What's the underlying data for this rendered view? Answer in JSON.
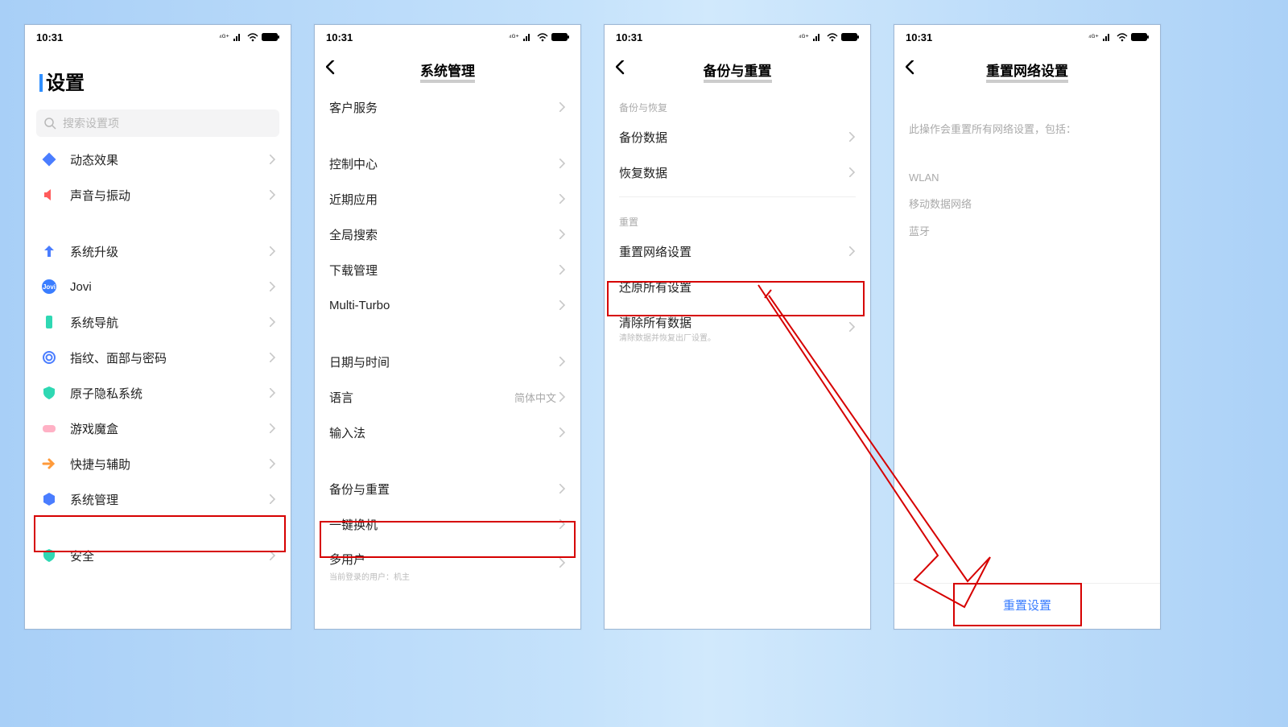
{
  "status": {
    "time": "10:31",
    "carrier_small": "⁴ᴳ⁺"
  },
  "screen1": {
    "title": "设置",
    "search_placeholder": "搜索设置项",
    "rows": {
      "dynamic": "动态效果",
      "sound": "声音与振动",
      "system_upgrade": "系统升级",
      "jovi": "Jovi",
      "system_nav": "系统导航",
      "biometric": "指纹、面部与密码",
      "privacy": "原子隐私系统",
      "game": "游戏魔盒",
      "shortcut": "快捷与辅助",
      "system_mgmt": "系统管理",
      "security": "安全"
    }
  },
  "screen2": {
    "title": "系统管理",
    "rows": {
      "customer_service": "客户服务",
      "control_center": "控制中心",
      "recent_apps": "近期应用",
      "global_search": "全局搜索",
      "download_mgmt": "下载管理",
      "multi_turbo": "Multi-Turbo",
      "date_time": "日期与时间",
      "language": "语言",
      "language_value": "简体中文",
      "ime": "输入法",
      "backup_reset": "备份与重置",
      "clone": "一键换机",
      "multi_user": "多用户",
      "multi_user_sub": "当前登录的用户：机主"
    }
  },
  "screen3": {
    "title": "备份与重置",
    "sections": {
      "backup": "备份与恢复",
      "reset": "重置"
    },
    "rows": {
      "backup_data": "备份数据",
      "restore_data": "恢复数据",
      "reset_network": "重置网络设置",
      "restore_all": "还原所有设置",
      "clear_all": "清除所有数据",
      "clear_all_sub": "清除数据并恢复出厂设置。"
    }
  },
  "screen4": {
    "title": "重置网络设置",
    "desc": "此操作会重置所有网络设置，包括：",
    "line1": "WLAN",
    "line2": "移动数据网络",
    "line3": "蓝牙",
    "button": "重置设置"
  }
}
